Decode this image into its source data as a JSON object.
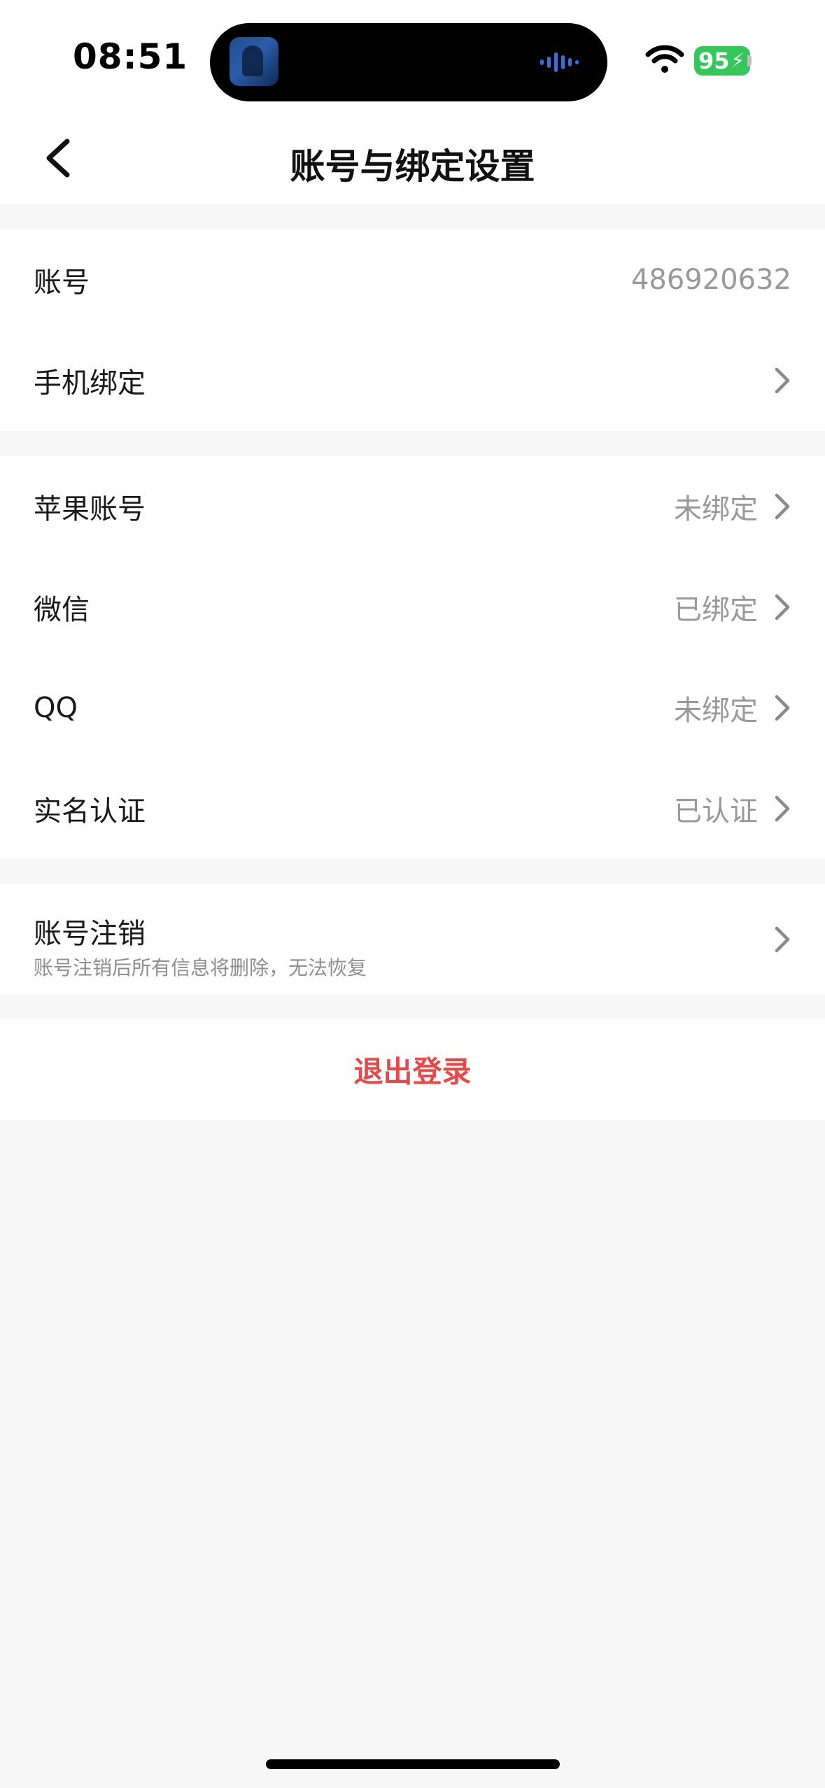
{
  "status_bar": {
    "time": "08:51",
    "battery": "95"
  },
  "nav": {
    "title": "账号与绑定设置",
    "back_icon": "chevron-left-icon"
  },
  "group1": {
    "account_label": "账号",
    "account_value": "486920632",
    "phone_label": "手机绑定"
  },
  "group2": {
    "apple_label": "苹果账号",
    "apple_status": "未绑定",
    "wechat_label": "微信",
    "wechat_status": "已绑定",
    "qq_label": "QQ",
    "qq_status": "未绑定",
    "realname_label": "实名认证",
    "realname_status": "已认证"
  },
  "group3": {
    "cancel_title": "账号注销",
    "cancel_subtitle": "账号注销后所有信息将删除，无法恢复"
  },
  "logout": {
    "label": "退出登录"
  },
  "colors": {
    "accent_red": "#e84848",
    "battery_green": "#34c759",
    "background": "#f7f7f8"
  }
}
